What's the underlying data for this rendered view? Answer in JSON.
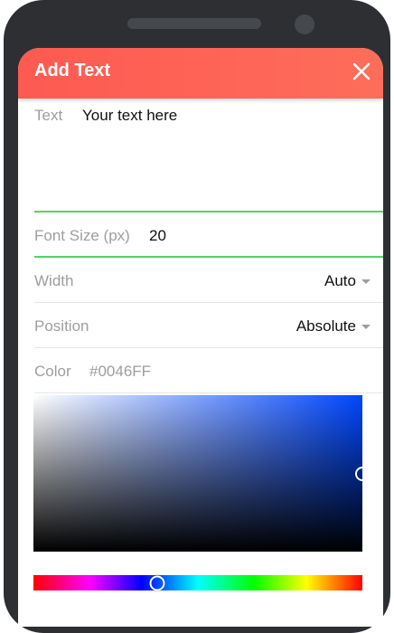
{
  "dialog": {
    "title": "Add Text",
    "close_icon": "close-icon",
    "header_color": "#fd5a51"
  },
  "fields": {
    "text": {
      "label": "Text",
      "value": "Your text here"
    },
    "font_size": {
      "label": "Font Size (px)",
      "value": "20"
    },
    "width": {
      "label": "Width",
      "selected": "Auto"
    },
    "position": {
      "label": "Position",
      "selected": "Absolute"
    },
    "color": {
      "label": "Color",
      "value": "#0046FF"
    }
  },
  "picker": {
    "selected_color": "#0046FF",
    "saturation": 1.0,
    "brightness": 0.5,
    "hue_fraction": 0.375,
    "focus_color": "#4fd36a"
  }
}
